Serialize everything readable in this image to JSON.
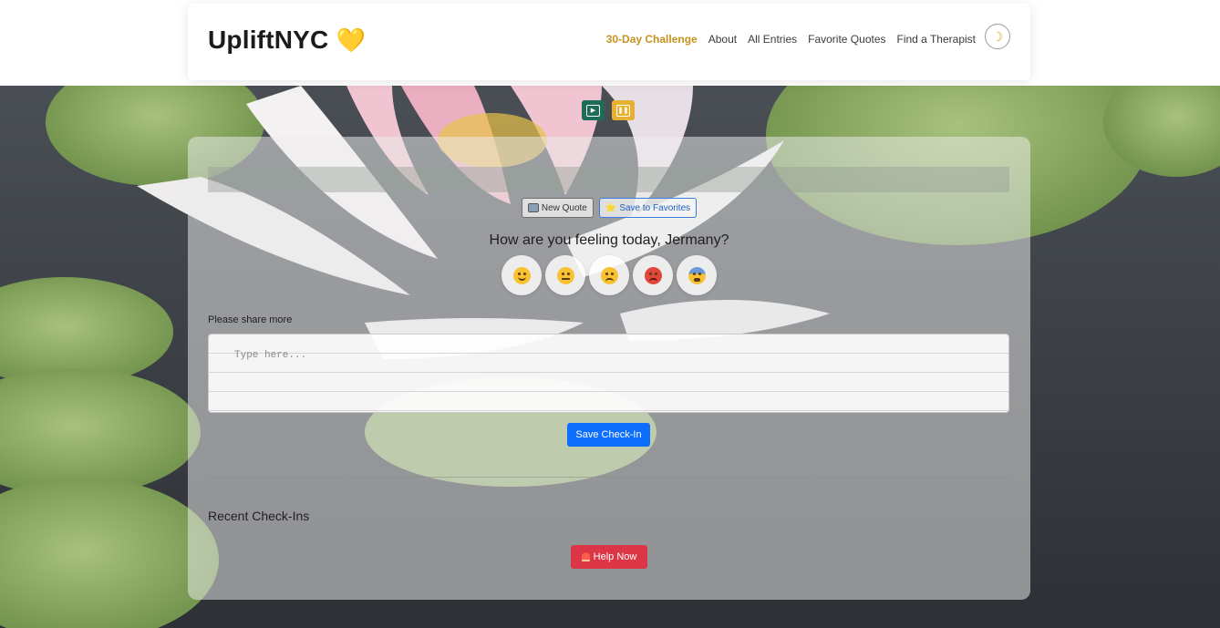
{
  "header": {
    "brand": "UpliftNYC",
    "brand_icon": "yellow-heart-icon",
    "nav": [
      {
        "label": "30-Day Challenge",
        "active": true
      },
      {
        "label": "About"
      },
      {
        "label": "All Entries"
      },
      {
        "label": "Favorite Quotes"
      },
      {
        "label": "Find a Therapist"
      }
    ],
    "theme_toggle_icon": "moon-icon"
  },
  "audio": {
    "play_icon": "play-icon",
    "pause_icon": "pause-icon"
  },
  "quote": {
    "text": "",
    "new_quote_label": "New Quote",
    "save_favorite_label": "Save to Favorites"
  },
  "checkin": {
    "prompt": "How are you feeling today, Jermany?",
    "moods": [
      "happy",
      "neutral",
      "sad",
      "angry",
      "anxious"
    ],
    "share_label": "Please share more",
    "placeholder": "Type here...",
    "save_label": "Save Check-In"
  },
  "recent": {
    "title": "Recent Check-Ins",
    "help_label": "Help Now"
  },
  "colors": {
    "accent_active_nav": "#c8921e",
    "primary": "#0d6efd",
    "danger": "#dc3545",
    "play_button": "#1e6b57",
    "pause_button": "#e8b030"
  }
}
